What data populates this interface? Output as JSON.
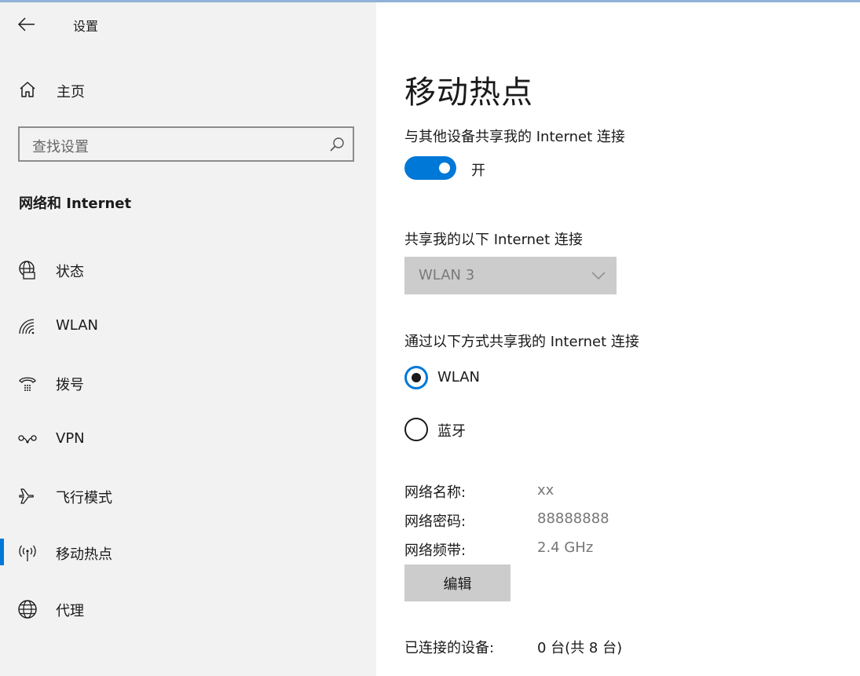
{
  "window": {
    "title": "设置",
    "back_icon": "arrow-left-icon"
  },
  "sidebar": {
    "home_label": "主页",
    "search_placeholder": "查找设置",
    "section_title": "网络和 Internet",
    "items": [
      {
        "label": "状态",
        "icon": "globe-monitor-icon",
        "selected": false
      },
      {
        "label": "WLAN",
        "icon": "wifi-icon",
        "selected": false
      },
      {
        "label": "拨号",
        "icon": "dialup-icon",
        "selected": false
      },
      {
        "label": "VPN",
        "icon": "vpn-icon",
        "selected": false
      },
      {
        "label": "飞行模式",
        "icon": "airplane-icon",
        "selected": false
      },
      {
        "label": "移动热点",
        "icon": "hotspot-icon",
        "selected": true
      },
      {
        "label": "代理",
        "icon": "globe-icon",
        "selected": false
      }
    ]
  },
  "main": {
    "title": "移动热点",
    "share_label": "与其他设备共享我的 Internet 连接",
    "toggle_state": "开",
    "toggle_on": true,
    "share_from_label": "共享我的以下 Internet 连接",
    "share_from_value": "WLAN 3",
    "share_via_label": "通过以下方式共享我的 Internet 连接",
    "share_via_options": [
      {
        "label": "WLAN",
        "checked": true
      },
      {
        "label": "蓝牙",
        "checked": false
      }
    ],
    "props": [
      {
        "key": "网络名称:",
        "value": "xx"
      },
      {
        "key": "网络密码:",
        "value": "88888888"
      },
      {
        "key": "网络频带:",
        "value": "2.4 GHz"
      }
    ],
    "edit_label": "编辑",
    "devices_key": "已连接的设备:",
    "devices_value": "0 台(共 8 台)"
  },
  "colors": {
    "accent": "#0078d7",
    "sidebar_bg": "#f2f2f2",
    "disabled_bg": "#cccccc",
    "warning_text": "#c50f1f"
  }
}
